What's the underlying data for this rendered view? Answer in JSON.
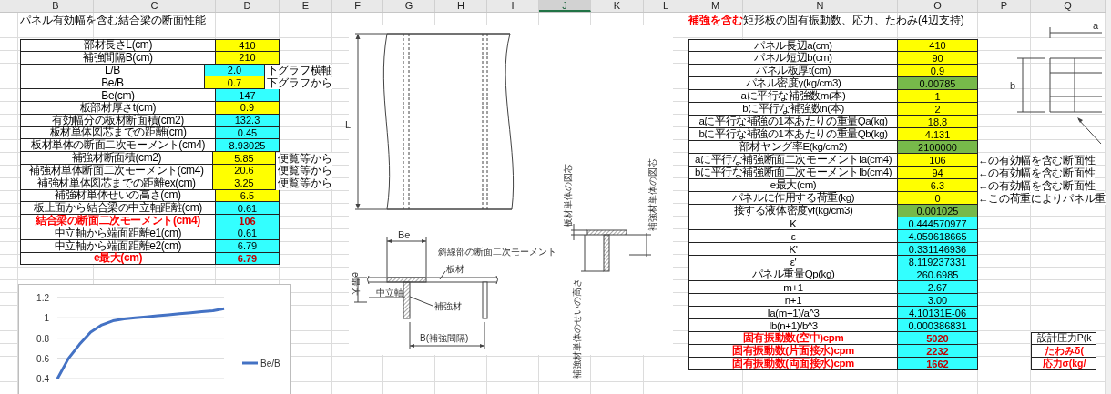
{
  "columns": [
    {
      "label": "B",
      "selected": false
    },
    {
      "label": "C",
      "selected": false
    },
    {
      "label": "D",
      "selected": false
    },
    {
      "label": "E",
      "selected": false
    },
    {
      "label": "F",
      "selected": false
    },
    {
      "label": "G",
      "selected": false
    },
    {
      "label": "H",
      "selected": false
    },
    {
      "label": "I",
      "selected": false
    },
    {
      "label": "J",
      "selected": true
    },
    {
      "label": "K",
      "selected": false
    },
    {
      "label": "L",
      "selected": false
    },
    {
      "label": "M",
      "selected": false
    },
    {
      "label": "N",
      "selected": false
    },
    {
      "label": "O",
      "selected": false
    },
    {
      "label": "P",
      "selected": false
    },
    {
      "label": "Q",
      "selected": false
    }
  ],
  "left_panel": {
    "title": "パネル有効幅を含む結合梁の断面性能",
    "rows": [
      {
        "label": "部材長さL(cm)",
        "value": "410",
        "kind": "input",
        "emphasis": false
      },
      {
        "label": "補強間隔B(cm)",
        "value": "210",
        "kind": "input",
        "emphasis": false
      },
      {
        "label": "L/B",
        "value": "2.0",
        "kind": "calc",
        "emphasis": false,
        "note": "下グラフ横軸"
      },
      {
        "label": "Be/B",
        "value": "0.7",
        "kind": "input",
        "emphasis": false,
        "note": "下グラフから"
      },
      {
        "label": "Be(cm)",
        "value": "147",
        "kind": "calc",
        "emphasis": false
      },
      {
        "label": "板部材厚さt(cm)",
        "value": "0.9",
        "kind": "input",
        "emphasis": false
      },
      {
        "label": "有効幅分の板材断面積(cm2)",
        "value": "132.3",
        "kind": "calc",
        "emphasis": false
      },
      {
        "label": "板材単体図芯までの距離(cm)",
        "value": "0.45",
        "kind": "calc",
        "emphasis": false
      },
      {
        "label": "板材単体の断面二次モーメント(cm4)",
        "value": "8.93025",
        "kind": "calc",
        "emphasis": false
      },
      {
        "label": "補強材断面積(cm2)",
        "value": "5.85",
        "kind": "input",
        "emphasis": false,
        "note": "便覧等から"
      },
      {
        "label": "補強材単体断面二次モーメント(cm4)",
        "value": "20.6",
        "kind": "input",
        "emphasis": false,
        "note": "便覧等から"
      },
      {
        "label": "補強材単体図芯までの距離ex(cm)",
        "value": "3.25",
        "kind": "input",
        "emphasis": false,
        "note": "便覧等から"
      },
      {
        "label": "補強材単体せいの高さ(cm)",
        "value": "6.5",
        "kind": "input",
        "emphasis": false
      },
      {
        "label": "板上面から結合梁の中立軸距離(cm)",
        "value": "0.61",
        "kind": "calc",
        "emphasis": false
      },
      {
        "label": "結合梁の断面二次モーメント(cm4)",
        "value": "106",
        "kind": "calc",
        "emphasis": true
      },
      {
        "label": "中立軸から端面距離e1(cm)",
        "value": "0.61",
        "kind": "calc",
        "emphasis": false
      },
      {
        "label": "中立軸から端面距離e2(cm)",
        "value": "6.79",
        "kind": "calc",
        "emphasis": false
      },
      {
        "label": "e最大(cm)",
        "value": "6.79",
        "kind": "calc",
        "emphasis": true
      }
    ],
    "chart_data": {
      "type": "line",
      "grid": true,
      "yticks": [
        0.4,
        0.6,
        0.8,
        1,
        1.2
      ],
      "ylim": [
        0.4,
        1.2
      ],
      "series": [
        {
          "name": "Be/B",
          "color": "#4472c4",
          "values": [
            0.4,
            0.6,
            0.74,
            0.86,
            0.93,
            0.97,
            0.99,
            1.0,
            1.01,
            1.02,
            1.03,
            1.04,
            1.05,
            1.06,
            1.07,
            1.09
          ]
        }
      ]
    }
  },
  "diagram": {
    "length_label": "L",
    "effective_width_label": "Be",
    "hatched_caption": "斜線部の断面二次モーメント",
    "plate_label": "板材",
    "neutral_axis_label": "中立軸",
    "stiffener_label": "補強材",
    "max_distance_label": "e最大",
    "spacing_label": "B(補強間隔)",
    "plate_centroid_label": "板材単体の図芯",
    "stiffener_centroid_label": "補強材単体の図芯",
    "stiffener_height_label": "補強材単体のせいの高さ"
  },
  "right_panel": {
    "title": "**補強を含む**矩形板の固有振動数、応力、たわみ(4辺支持)",
    "diagram": {
      "a_label": "a",
      "b_label": "b"
    },
    "rows": [
      {
        "label": "パネル長辺a(cm)",
        "value": "410",
        "kind": "input",
        "emphasis": false
      },
      {
        "label": "パネル短辺b(cm)",
        "value": "90",
        "kind": "input",
        "emphasis": false
      },
      {
        "label": "パネル板厚t(cm)",
        "value": "0.9",
        "kind": "input",
        "emphasis": false
      },
      {
        "label": "パネル密度γ(kg/cm3)",
        "value": "0.00785",
        "kind": "const",
        "emphasis": false
      },
      {
        "label": "aに平行な補強数m(本)",
        "value": "1",
        "kind": "input",
        "emphasis": false
      },
      {
        "label": "bに平行な補強数n(本)",
        "value": "2",
        "kind": "input",
        "emphasis": false
      },
      {
        "label": "aに平行な補強の1本あたりの重量Qa(kg)",
        "value": "18.8",
        "kind": "input",
        "emphasis": false
      },
      {
        "label": "bに平行な補強の1本あたりの重量Qb(kg)",
        "value": "4.131",
        "kind": "input",
        "emphasis": false
      },
      {
        "label": "部材ヤング率E(kg/cm2)",
        "value": "2100000",
        "kind": "const",
        "emphasis": false
      },
      {
        "label": "aに平行な補強断面二次モーメントIa(cm4)",
        "value": "106",
        "kind": "input",
        "emphasis": false,
        "note": "←の有効幅を含む断面性"
      },
      {
        "label": "bに平行な補強断面二次モーメントIb(cm4)",
        "value": "94",
        "kind": "input",
        "emphasis": false,
        "note": "←の有効幅を含む断面性"
      },
      {
        "label": "e最大(cm)",
        "value": "6.3",
        "kind": "input",
        "emphasis": false,
        "note": "←の有効幅を含む断面性"
      },
      {
        "label": "パネルに作用する荷重(kg)",
        "value": "0",
        "kind": "input",
        "emphasis": false,
        "note": "←この荷重によりパネル重"
      },
      {
        "label": "接する液体密度γf(kg/cm3)",
        "value": "0.001025",
        "kind": "const",
        "emphasis": false
      },
      {
        "label": "K",
        "value": "0.444570977",
        "kind": "calc",
        "emphasis": false
      },
      {
        "label": "ε",
        "value": "4.059618665",
        "kind": "calc",
        "emphasis": false
      },
      {
        "label": "K'",
        "value": "0.331146936",
        "kind": "calc",
        "emphasis": false
      },
      {
        "label": "ε'",
        "value": "8.119237331",
        "kind": "calc",
        "emphasis": false
      },
      {
        "label": "パネル重量Qp(kg)",
        "value": "260.6985",
        "kind": "calc",
        "emphasis": false
      },
      {
        "label": "m+1",
        "value": "2.67",
        "kind": "calc",
        "emphasis": false
      },
      {
        "label": "n+1",
        "value": "3.00",
        "kind": "calc",
        "emphasis": false
      },
      {
        "label": "Ia(m+1)/a^3",
        "value": "4.10131E-06",
        "kind": "calc",
        "emphasis": false
      },
      {
        "label": "Ib(n+1)/b^3",
        "value": "0.000386831",
        "kind": "calc",
        "emphasis": false
      },
      {
        "label": "固有振動数(空中)cpm",
        "value": "5020",
        "kind": "calc",
        "emphasis": true,
        "side": {
          "label": "設計圧力P(k",
          "emphasis": false
        }
      },
      {
        "label": "固有振動数(片面接水)cpm",
        "value": "2232",
        "kind": "calc",
        "emphasis": true,
        "side": {
          "label": "たわみδ(",
          "emphasis": true
        }
      },
      {
        "label": "固有振動数(両面接水)cpm",
        "value": "1662",
        "kind": "calc",
        "emphasis": true,
        "side": {
          "label": "応力σ(kg/",
          "emphasis": true
        }
      }
    ]
  }
}
